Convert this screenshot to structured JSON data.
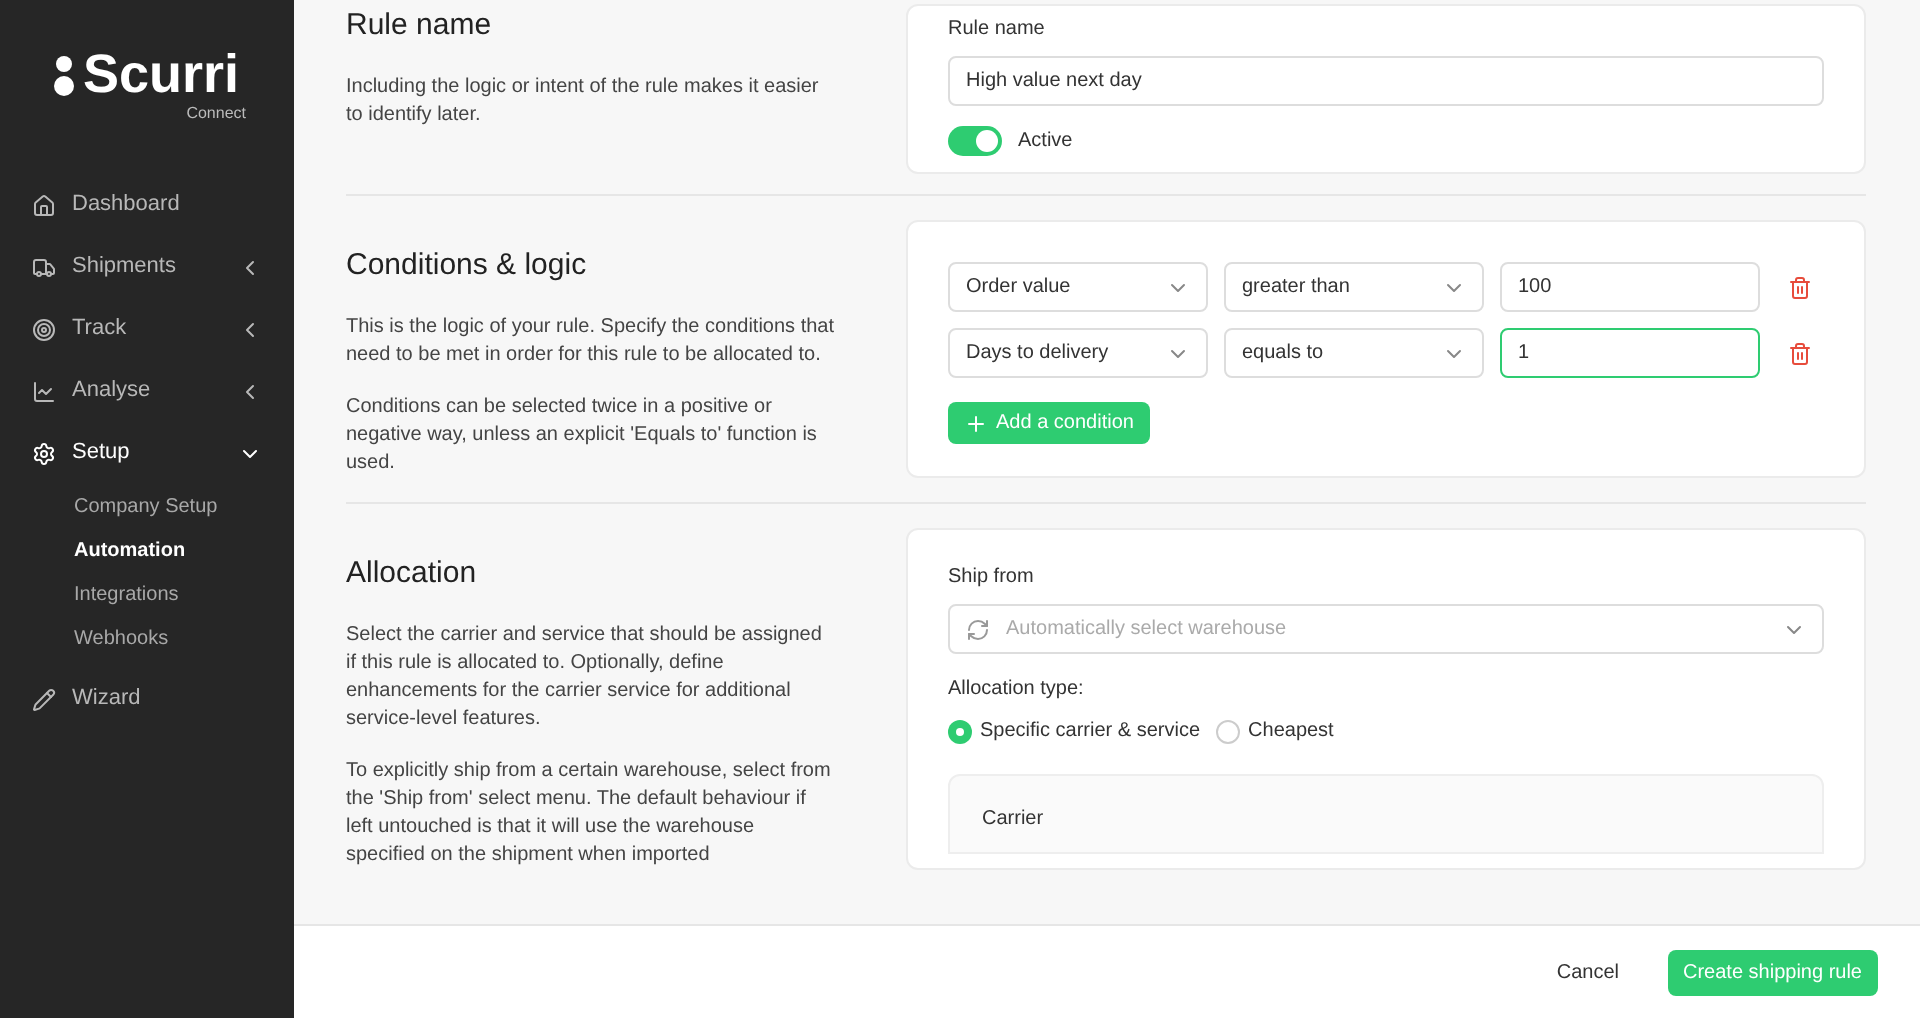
{
  "sidebar": {
    "logo": {
      "name": "Scurri",
      "sub": "Connect"
    },
    "items": [
      {
        "label": "Dashboard",
        "kind": "link",
        "selected": false
      },
      {
        "label": "Shipments",
        "kind": "group",
        "expanded": false,
        "selected": false
      },
      {
        "label": "Track",
        "kind": "group",
        "expanded": false,
        "selected": false
      },
      {
        "label": "Analyse",
        "kind": "group",
        "expanded": false,
        "selected": false
      },
      {
        "label": "Setup",
        "kind": "group",
        "expanded": true,
        "selected": true,
        "children": [
          {
            "label": "Company Setup",
            "selected": false
          },
          {
            "label": "Automation",
            "selected": true
          },
          {
            "label": "Integrations",
            "selected": false
          },
          {
            "label": "Webhooks",
            "selected": false
          }
        ]
      },
      {
        "label": "Wizard",
        "kind": "link",
        "selected": false
      }
    ]
  },
  "rule_name": {
    "title": "Rule name",
    "paragraphs": [
      "Including the logic or intent of the rule makes it easier to identify later."
    ],
    "field_label": "Rule name",
    "value": "High value next day",
    "toggle": {
      "label": "Active",
      "on": true
    }
  },
  "conditions": {
    "title": "Conditions & logic",
    "paragraphs": [
      "This is the logic of your rule. Specify the conditions that need to be met in order for this rule to be allocated to.",
      "Conditions can be selected twice in a positive or negative way, unless an explicit 'Equals to' function is used."
    ],
    "rows": [
      {
        "field": "Order value",
        "operator": "greater than",
        "value": "100",
        "focused": false
      },
      {
        "field": "Days to delivery",
        "operator": "equals to",
        "value": "1",
        "focused": true
      }
    ],
    "add_button": "Add a condition"
  },
  "allocation": {
    "title": "Allocation",
    "paragraphs": [
      "Select the carrier and service that should be assigned if this rule is allocated to. Optionally, define enhancements for the carrier service for additional service-level features.",
      "To explicitly ship from a certain warehouse, select from the 'Ship from' select menu. The default behaviour if left untouched is that it will use the warehouse specified on the shipment when imported"
    ],
    "ship_from": {
      "label": "Ship from",
      "placeholder": "Automatically select warehouse"
    },
    "type_label": "Allocation type:",
    "types": [
      {
        "label": "Specific carrier & service",
        "selected": true
      },
      {
        "label": "Cheapest",
        "selected": false
      }
    ],
    "carrier_label": "Carrier"
  },
  "footer": {
    "cancel": "Cancel",
    "submit": "Create shipping rule"
  }
}
